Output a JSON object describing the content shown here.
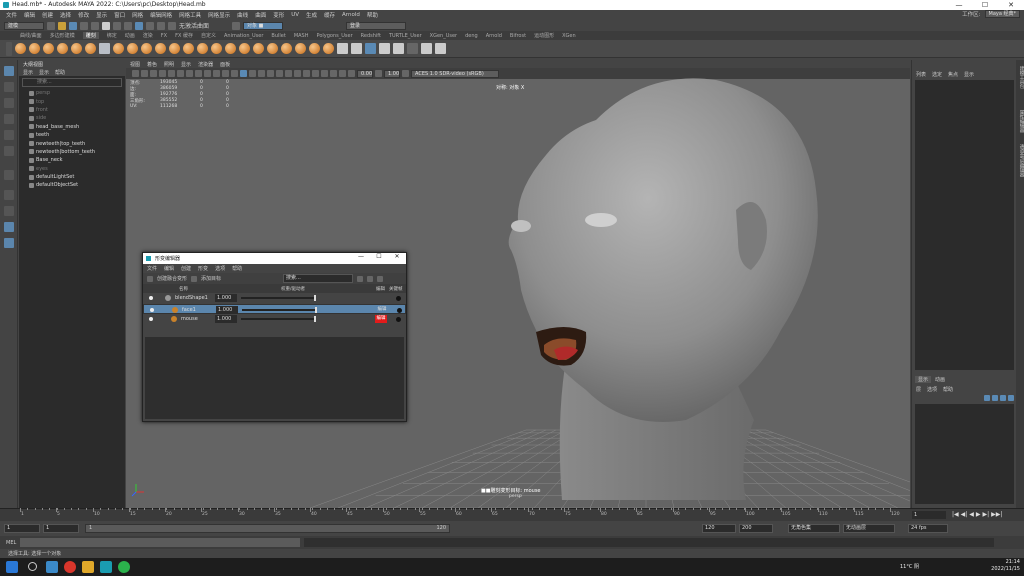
{
  "window": {
    "title": "Head.mb* - Autodesk MAYA 2022: C:\\Users\\pc\\Desktop\\Head.mb",
    "controls": [
      "—",
      "☐",
      "✕"
    ]
  },
  "menubar": {
    "items": [
      "文件",
      "编辑",
      "创建",
      "选择",
      "修改",
      "显示",
      "窗口",
      "网格",
      "编辑网格",
      "网格工具",
      "网格显示",
      "曲线",
      "曲面",
      "变形",
      "UV",
      "生成",
      "缓存",
      "Arnold",
      "帮助"
    ],
    "workspace_label": "工作区:",
    "workspace_value": "Maya 经典*"
  },
  "statusline": {
    "mode": "建模",
    "no_live": "无激活曲面",
    "object_mode": "对象 ■",
    "login": "登录"
  },
  "shelf": {
    "tabs": [
      "曲线/曲面",
      "多边形建模",
      "雕刻",
      "绑定",
      "动画",
      "渲染",
      "FX",
      "FX 缓存",
      "自定义",
      "Animation_User",
      "Bullet",
      "MASH",
      "Polygons_User",
      "Redshift",
      "TURTLE_User",
      "XGen_User",
      "deng",
      "Arnold",
      "Bifrost",
      "运动图形",
      "XGen"
    ],
    "active_tab": "雕刻"
  },
  "outliner": {
    "title": "大纲视图",
    "menu": [
      "显示",
      "显示",
      "帮助"
    ],
    "search_placeholder": "搜索...",
    "items": [
      {
        "label": "persp",
        "dim": true
      },
      {
        "label": "top",
        "dim": true
      },
      {
        "label": "front",
        "dim": true
      },
      {
        "label": "side",
        "dim": true
      },
      {
        "label": "head_base_mesh",
        "dim": false
      },
      {
        "label": "teeth",
        "dim": false
      },
      {
        "label": "newteeth|top_teeth",
        "dim": false
      },
      {
        "label": "newteeth|bottom_teeth",
        "dim": false
      },
      {
        "label": "Base_neck",
        "dim": false
      },
      {
        "label": "eyes",
        "dim": true
      },
      {
        "label": "defaultLightSet",
        "dim": false
      },
      {
        "label": "defaultObjectSet",
        "dim": false
      }
    ]
  },
  "viewport": {
    "menu": [
      "视图",
      "着色",
      "照明",
      "显示",
      "渲染器",
      "面板"
    ],
    "exposure": "0.00",
    "gamma": "1.00",
    "colorspace": "ACES 1.0 SDR-video (sRGB)",
    "hud": [
      {
        "k": "顶点:",
        "v": "193045",
        "a": "0",
        "b": "0"
      },
      {
        "k": "边:",
        "v": "386059",
        "a": "0",
        "b": "0"
      },
      {
        "k": "面:",
        "v": "192776",
        "a": "0",
        "b": "0"
      },
      {
        "k": "三角形:",
        "v": "385552",
        "a": "0",
        "b": "0"
      },
      {
        "k": "UV:",
        "v": "111268",
        "a": "0",
        "b": "0"
      }
    ],
    "symmetry_label": "对称: 对象 X",
    "camera_label": "■■雕刻变形目标: mouse",
    "camera_name": "persp"
  },
  "shape_editor": {
    "title": "形变编辑器",
    "controls": [
      "—",
      "☐",
      "✕"
    ],
    "menu": [
      "文件",
      "编辑",
      "创建",
      "形变",
      "选项",
      "帮助"
    ],
    "create_blend_label": "创建融合变形",
    "add_target_label": "添加目标",
    "search_placeholder": "搜索...",
    "col_name": "名称",
    "col_weight": "权重/驱动者",
    "col_edit": "编辑",
    "col_key": "关键帧",
    "rows": [
      {
        "name": "blendShape1",
        "value": "1.000",
        "edit": "",
        "selected": false,
        "indent": 0
      },
      {
        "name": "face1",
        "value": "1.000",
        "edit": "编辑",
        "selected": true,
        "indent": 1
      },
      {
        "name": "mouse",
        "value": "1.000",
        "edit": "编辑",
        "selected": false,
        "indent": 1
      }
    ]
  },
  "right_panel": {
    "menu": [
      "列表",
      "选定",
      "焦点",
      "属性",
      "显示",
      "帮助"
    ],
    "layer_tabs": [
      "显示",
      "动画"
    ],
    "layer_menu": [
      "层",
      "选项",
      "帮助"
    ]
  },
  "vtabs": [
    "建模工具包",
    "属性编辑器",
    "通道盒/层编辑器"
  ],
  "timeline": {
    "ticks": [
      "1",
      "5",
      "10",
      "15",
      "20",
      "25",
      "30",
      "35",
      "40",
      "45",
      "50",
      "55",
      "60",
      "65",
      "70",
      "75",
      "80",
      "85",
      "90",
      "95",
      "100",
      "105",
      "110",
      "115",
      "120"
    ],
    "current": "1",
    "playback": [
      "|◀",
      "◀|",
      "◀",
      "▶",
      "▶|",
      "▶▶|"
    ]
  },
  "range": {
    "start": "1",
    "inner_start": "1",
    "bar_left": "1",
    "bar_right": "120",
    "inner_end": "120",
    "end": "200",
    "char_set": "无角色集",
    "anim_layer": "无动画层",
    "fps": "24 fps"
  },
  "mel": {
    "label": "MEL"
  },
  "helpline": {
    "text": "选择工具: 选择一个对象"
  },
  "taskbar": {
    "weather": "11°C 阴",
    "time": "21:14",
    "date": "2022/11/15"
  },
  "colors": {
    "accent": "#5b86ad",
    "edit_red": "#e21b1b"
  }
}
